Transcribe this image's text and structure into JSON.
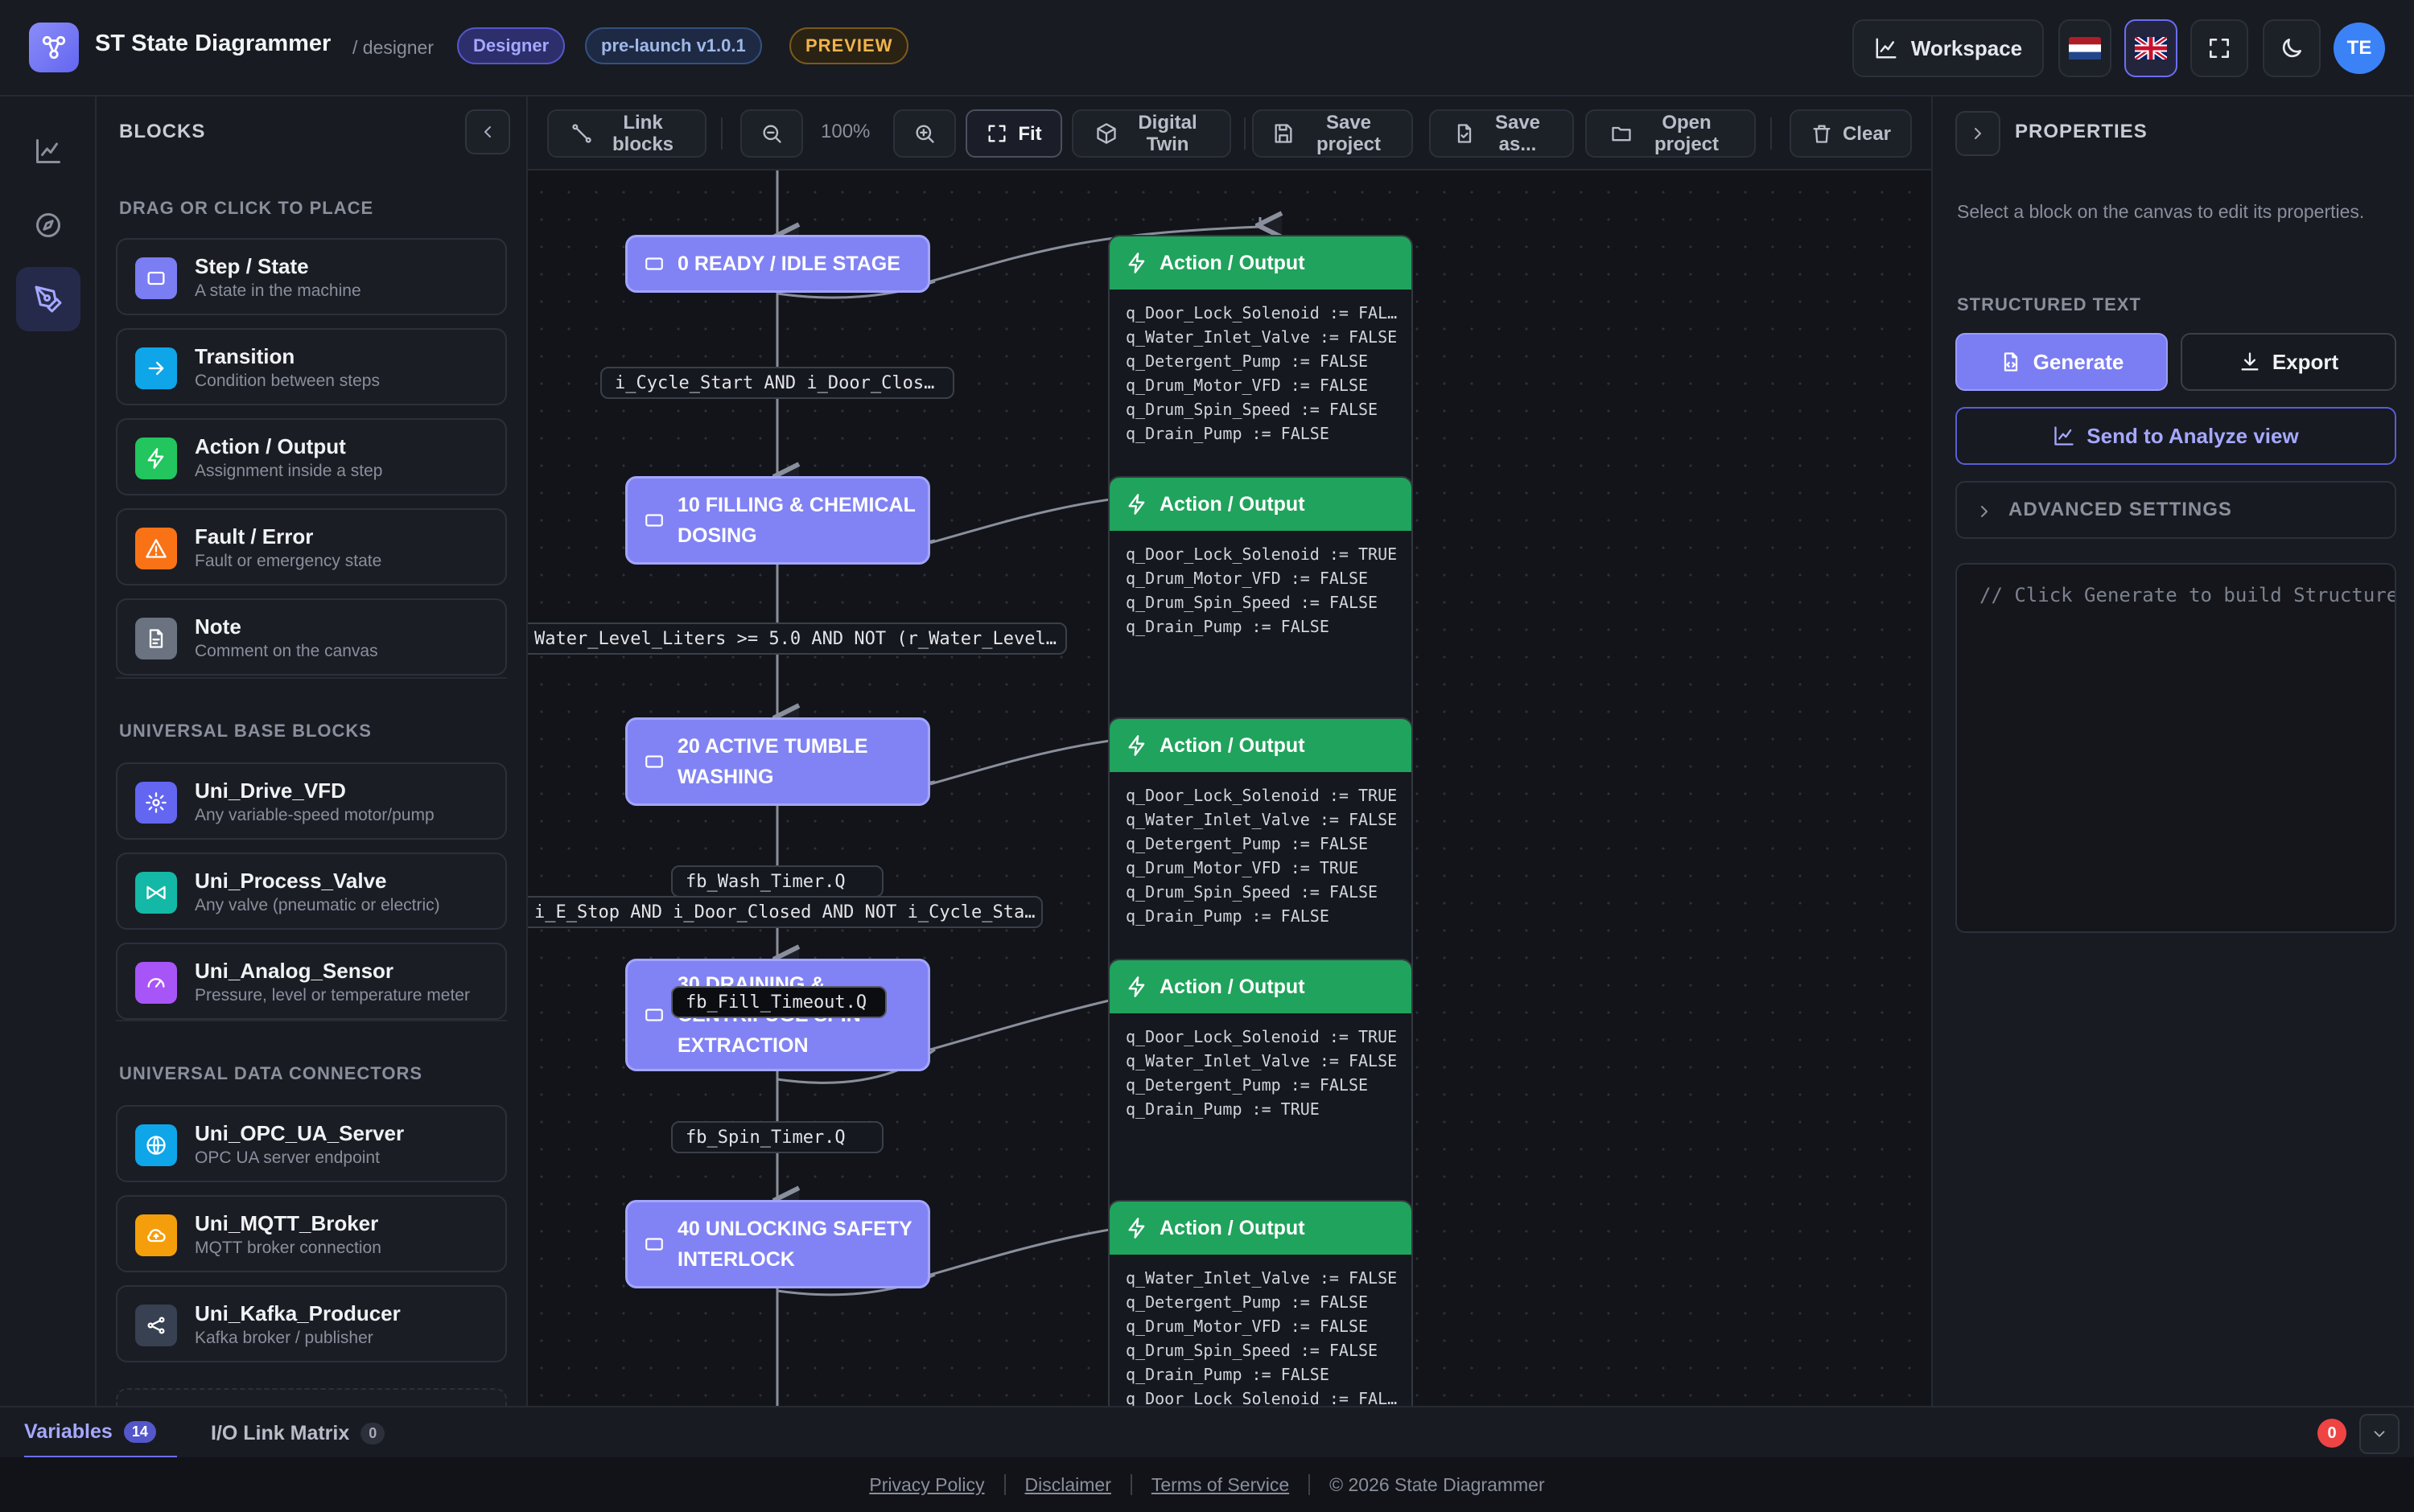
{
  "header": {
    "app_title": "ST State Diagrammer",
    "app_subtitle": "/ designer",
    "badge_mode": "Designer",
    "badge_version": "pre-launch v1.0.1",
    "badge_preview": "PREVIEW",
    "workspace_label": "Workspace",
    "avatar_initials": "TE"
  },
  "rail": {
    "items": [
      {
        "name": "analytics-view",
        "icon": "chart-line-icon"
      },
      {
        "name": "explore-view",
        "icon": "compass-icon"
      },
      {
        "name": "designer-view",
        "icon": "pen-tool-icon",
        "active": true
      }
    ]
  },
  "blocks": {
    "title": "BLOCKS",
    "section_place": "DRAG OR CLICK TO PLACE",
    "section_base": "UNIVERSAL BASE BLOCKS",
    "section_connectors": "UNIVERSAL DATA CONNECTORS",
    "place": [
      {
        "name": "Step / State",
        "desc": "A state in the machine",
        "icon": "square-icon",
        "color": "#7b7df2"
      },
      {
        "name": "Transition",
        "desc": "Condition between steps",
        "icon": "arrow-right-icon",
        "color": "#0ea5e9"
      },
      {
        "name": "Action / Output",
        "desc": "Assignment inside a step",
        "icon": "zap-icon",
        "color": "#22c55e"
      },
      {
        "name": "Fault / Error",
        "desc": "Fault or emergency state",
        "icon": "warning-icon",
        "color": "#f97316"
      },
      {
        "name": "Note",
        "desc": "Comment on the canvas",
        "icon": "file-icon",
        "color": "#6b7280"
      }
    ],
    "base": [
      {
        "name": "Uni_Drive_VFD",
        "desc": "Any variable-speed motor/pump",
        "icon": "gear-icon",
        "color": "#6366f1"
      },
      {
        "name": "Uni_Process_Valve",
        "desc": "Any valve (pneumatic or electric)",
        "icon": "valve-icon",
        "color": "#14b8a6"
      },
      {
        "name": "Uni_Analog_Sensor",
        "desc": "Pressure, level or temperature meter",
        "icon": "gauge-icon",
        "color": "#a855f7"
      }
    ],
    "connectors": [
      {
        "name": "Uni_OPC_UA_Server",
        "desc": "OPC UA server endpoint",
        "icon": "globe-icon",
        "color": "#0ea5e9"
      },
      {
        "name": "Uni_MQTT_Broker",
        "desc": "MQTT broker connection",
        "icon": "cloud-icon",
        "color": "#f59e0b"
      },
      {
        "name": "Uni_Kafka_Producer",
        "desc": "Kafka broker / publisher",
        "icon": "share-icon",
        "color": "#374151"
      }
    ]
  },
  "toolbar": {
    "link_blocks": "Link blocks",
    "zoom_level": "100%",
    "fit": "Fit",
    "digital_twin": "Digital Twin",
    "save_project": "Save project",
    "save_as": "Save as...",
    "open_project": "Open project",
    "clear": "Clear"
  },
  "diagram": {
    "states": [
      "0 READY / IDLE STAGE",
      "10 FILLING & CHEMICAL DOSING",
      "20 ACTIVE TUMBLE WASHING",
      "30 DRAINING & CENTRIFUGE SPIN EXTRACTION",
      "40 UNLOCKING SAFETY INTERLOCK"
    ],
    "action_title": "Action / Output",
    "actions": [
      [
        "q_Door_Lock_Solenoid := FAL…",
        "q_Water_Inlet_Valve := FALSE",
        "q_Detergent_Pump := FALSE",
        "q_Drum_Motor_VFD := FALSE",
        "q_Drum_Spin_Speed := FALSE",
        "q_Drain_Pump := FALSE"
      ],
      [
        "q_Door_Lock_Solenoid := TRUE",
        "q_Drum_Motor_VFD := FALSE",
        "q_Drum_Spin_Speed := FALSE",
        "q_Drain_Pump := FALSE"
      ],
      [
        "q_Door_Lock_Solenoid := TRUE",
        "q_Water_Inlet_Valve := FALSE",
        "q_Detergent_Pump := FALSE",
        "q_Drum_Motor_VFD := TRUE",
        "q_Drum_Spin_Speed := FALSE",
        "q_Drain_Pump := FALSE"
      ],
      [
        "q_Door_Lock_Solenoid := TRUE",
        "q_Water_Inlet_Valve := FALSE",
        "q_Detergent_Pump := FALSE",
        "q_Drain_Pump := TRUE"
      ],
      [
        "q_Water_Inlet_Valve := FALSE",
        "q_Detergent_Pump := FALSE",
        "q_Drum_Motor_VFD := FALSE",
        "q_Drum_Spin_Speed := FALSE",
        "q_Drain_Pump := FALSE",
        "q_Door_Lock_Solenoid := FAL…"
      ]
    ],
    "conditions": [
      "i_Cycle_Start AND i_Door_Clos…",
      "Water_Level_Liters >= 5.0 AND NOT (r_Water_Level…",
      "fb_Wash_Timer.Q",
      "i_E_Stop AND i_Door_Closed AND NOT i_Cycle_Sta…",
      "fb_Fill_Timeout.Q",
      "fb_Spin_Timer.Q"
    ]
  },
  "properties": {
    "title": "PROPERTIES",
    "hint": "Select a block on the canvas to edit its properties.",
    "section_st": "STRUCTURED TEXT",
    "generate": "Generate",
    "export": "Export",
    "send_analyze": "Send to Analyze view",
    "advanced": "ADVANCED SETTINGS",
    "code_placeholder": "// Click Generate to build Structured Text"
  },
  "bottombar": {
    "variables_label": "Variables",
    "variables_count": "14",
    "io_label": "I/O Link Matrix",
    "io_count": "0",
    "error_count": "0"
  },
  "footer": {
    "privacy": "Privacy Policy",
    "disclaimer": "Disclaimer",
    "terms": "Terms of Service",
    "copyright": "© 2026 State Diagrammer"
  }
}
